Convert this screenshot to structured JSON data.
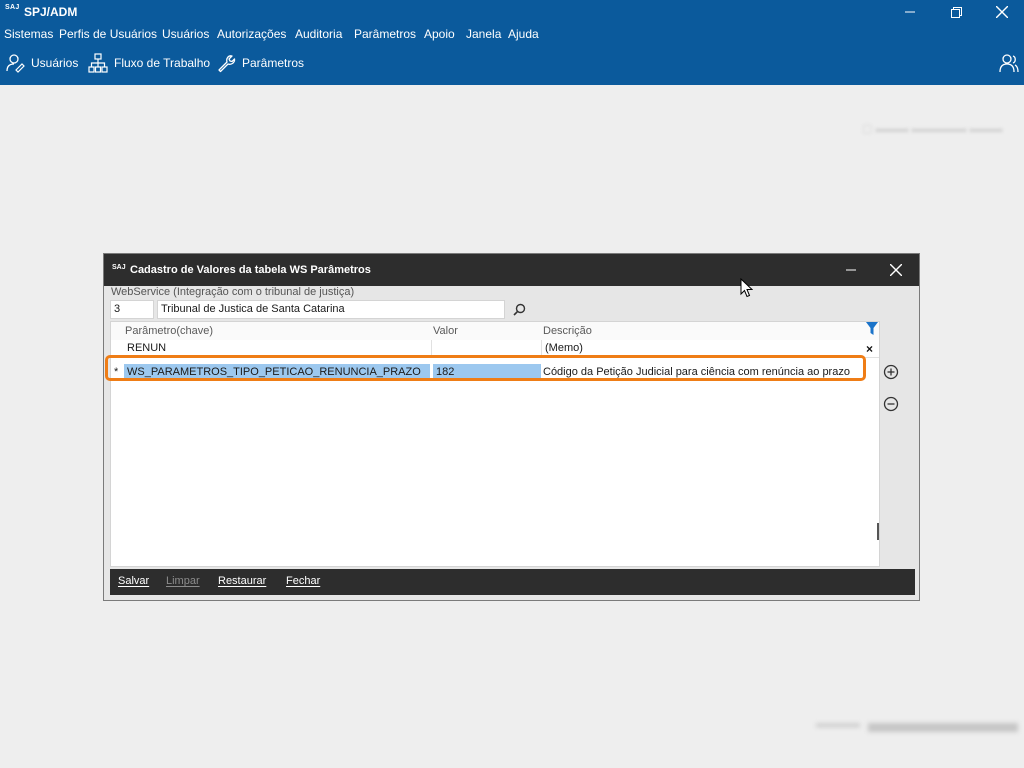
{
  "app": {
    "logo": "SAJ",
    "title": "SPJ/ADM"
  },
  "menu": [
    "Sistemas",
    "Perfis de Usuários",
    "Usuários",
    "Autorizações",
    "Auditoria",
    "Parâmetros",
    "Apoio",
    "Janela",
    "Ajuda"
  ],
  "toolbar": {
    "usuarios": "Usuários",
    "fluxo": "Fluxo de Trabalho",
    "parametros": "Parâmetros"
  },
  "dialog": {
    "logo": "SAJ",
    "title": "Cadastro de Valores da tabela WS Parâmetros",
    "webservice_label": "WebService (Integração com o tribunal de justiça)",
    "webservice_code": "3",
    "webservice_name": "Tribunal de Justica de Santa Catarina",
    "grid": {
      "columns": [
        "Parâmetro(chave)",
        "Valor",
        "Descrição"
      ],
      "filter": {
        "parametro": "RENUN",
        "valor": "",
        "descricao": "(Memo)"
      },
      "rows": [
        {
          "marker": "*",
          "parametro": "WS_PARAMETROS_TIPO_PETICAO_RENUNCIA_PRAZO",
          "valor": "182",
          "descricao": "Código da Petição Judicial para ciência com renúncia ao prazo"
        }
      ]
    },
    "footer": {
      "salvar": "Salvar",
      "limpar": "Limpar",
      "restaurar": "Restaurar",
      "fechar": "Fechar"
    }
  },
  "colors": {
    "app_blue": "#0b5a9c",
    "dialog_dark": "#2d2d2d",
    "selection": "#9cc8ef",
    "highlight_orange": "#ef7d16",
    "filter_blue": "#1a73c9"
  }
}
